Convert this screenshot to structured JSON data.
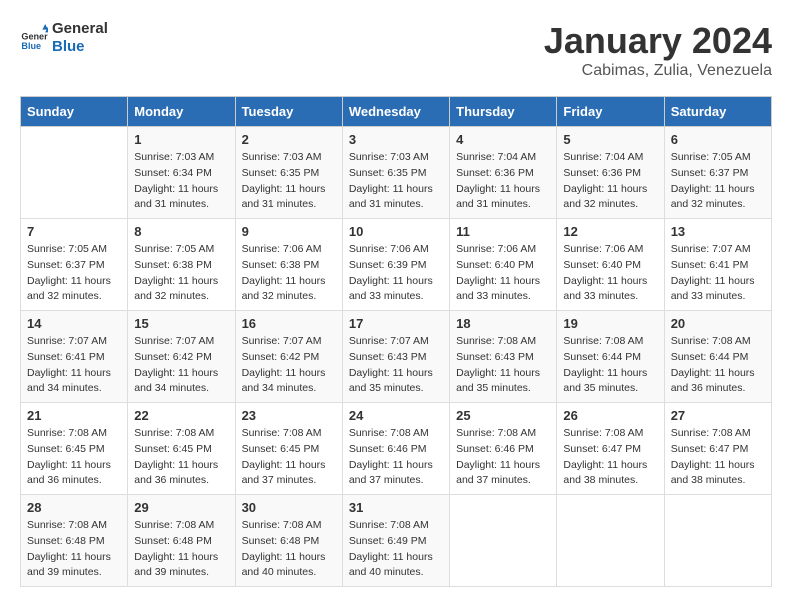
{
  "header": {
    "logo_line1": "General",
    "logo_line2": "Blue",
    "month_title": "January 2024",
    "subtitle": "Cabimas, Zulia, Venezuela"
  },
  "weekdays": [
    "Sunday",
    "Monday",
    "Tuesday",
    "Wednesday",
    "Thursday",
    "Friday",
    "Saturday"
  ],
  "weeks": [
    [
      {
        "day": "",
        "info": ""
      },
      {
        "day": "1",
        "info": "Sunrise: 7:03 AM\nSunset: 6:34 PM\nDaylight: 11 hours\nand 31 minutes."
      },
      {
        "day": "2",
        "info": "Sunrise: 7:03 AM\nSunset: 6:35 PM\nDaylight: 11 hours\nand 31 minutes."
      },
      {
        "day": "3",
        "info": "Sunrise: 7:03 AM\nSunset: 6:35 PM\nDaylight: 11 hours\nand 31 minutes."
      },
      {
        "day": "4",
        "info": "Sunrise: 7:04 AM\nSunset: 6:36 PM\nDaylight: 11 hours\nand 31 minutes."
      },
      {
        "day": "5",
        "info": "Sunrise: 7:04 AM\nSunset: 6:36 PM\nDaylight: 11 hours\nand 32 minutes."
      },
      {
        "day": "6",
        "info": "Sunrise: 7:05 AM\nSunset: 6:37 PM\nDaylight: 11 hours\nand 32 minutes."
      }
    ],
    [
      {
        "day": "7",
        "info": "Sunrise: 7:05 AM\nSunset: 6:37 PM\nDaylight: 11 hours\nand 32 minutes."
      },
      {
        "day": "8",
        "info": "Sunrise: 7:05 AM\nSunset: 6:38 PM\nDaylight: 11 hours\nand 32 minutes."
      },
      {
        "day": "9",
        "info": "Sunrise: 7:06 AM\nSunset: 6:38 PM\nDaylight: 11 hours\nand 32 minutes."
      },
      {
        "day": "10",
        "info": "Sunrise: 7:06 AM\nSunset: 6:39 PM\nDaylight: 11 hours\nand 33 minutes."
      },
      {
        "day": "11",
        "info": "Sunrise: 7:06 AM\nSunset: 6:40 PM\nDaylight: 11 hours\nand 33 minutes."
      },
      {
        "day": "12",
        "info": "Sunrise: 7:06 AM\nSunset: 6:40 PM\nDaylight: 11 hours\nand 33 minutes."
      },
      {
        "day": "13",
        "info": "Sunrise: 7:07 AM\nSunset: 6:41 PM\nDaylight: 11 hours\nand 33 minutes."
      }
    ],
    [
      {
        "day": "14",
        "info": "Sunrise: 7:07 AM\nSunset: 6:41 PM\nDaylight: 11 hours\nand 34 minutes."
      },
      {
        "day": "15",
        "info": "Sunrise: 7:07 AM\nSunset: 6:42 PM\nDaylight: 11 hours\nand 34 minutes."
      },
      {
        "day": "16",
        "info": "Sunrise: 7:07 AM\nSunset: 6:42 PM\nDaylight: 11 hours\nand 34 minutes."
      },
      {
        "day": "17",
        "info": "Sunrise: 7:07 AM\nSunset: 6:43 PM\nDaylight: 11 hours\nand 35 minutes."
      },
      {
        "day": "18",
        "info": "Sunrise: 7:08 AM\nSunset: 6:43 PM\nDaylight: 11 hours\nand 35 minutes."
      },
      {
        "day": "19",
        "info": "Sunrise: 7:08 AM\nSunset: 6:44 PM\nDaylight: 11 hours\nand 35 minutes."
      },
      {
        "day": "20",
        "info": "Sunrise: 7:08 AM\nSunset: 6:44 PM\nDaylight: 11 hours\nand 36 minutes."
      }
    ],
    [
      {
        "day": "21",
        "info": "Sunrise: 7:08 AM\nSunset: 6:45 PM\nDaylight: 11 hours\nand 36 minutes."
      },
      {
        "day": "22",
        "info": "Sunrise: 7:08 AM\nSunset: 6:45 PM\nDaylight: 11 hours\nand 36 minutes."
      },
      {
        "day": "23",
        "info": "Sunrise: 7:08 AM\nSunset: 6:45 PM\nDaylight: 11 hours\nand 37 minutes."
      },
      {
        "day": "24",
        "info": "Sunrise: 7:08 AM\nSunset: 6:46 PM\nDaylight: 11 hours\nand 37 minutes."
      },
      {
        "day": "25",
        "info": "Sunrise: 7:08 AM\nSunset: 6:46 PM\nDaylight: 11 hours\nand 37 minutes."
      },
      {
        "day": "26",
        "info": "Sunrise: 7:08 AM\nSunset: 6:47 PM\nDaylight: 11 hours\nand 38 minutes."
      },
      {
        "day": "27",
        "info": "Sunrise: 7:08 AM\nSunset: 6:47 PM\nDaylight: 11 hours\nand 38 minutes."
      }
    ],
    [
      {
        "day": "28",
        "info": "Sunrise: 7:08 AM\nSunset: 6:48 PM\nDaylight: 11 hours\nand 39 minutes."
      },
      {
        "day": "29",
        "info": "Sunrise: 7:08 AM\nSunset: 6:48 PM\nDaylight: 11 hours\nand 39 minutes."
      },
      {
        "day": "30",
        "info": "Sunrise: 7:08 AM\nSunset: 6:48 PM\nDaylight: 11 hours\nand 40 minutes."
      },
      {
        "day": "31",
        "info": "Sunrise: 7:08 AM\nSunset: 6:49 PM\nDaylight: 11 hours\nand 40 minutes."
      },
      {
        "day": "",
        "info": ""
      },
      {
        "day": "",
        "info": ""
      },
      {
        "day": "",
        "info": ""
      }
    ]
  ]
}
